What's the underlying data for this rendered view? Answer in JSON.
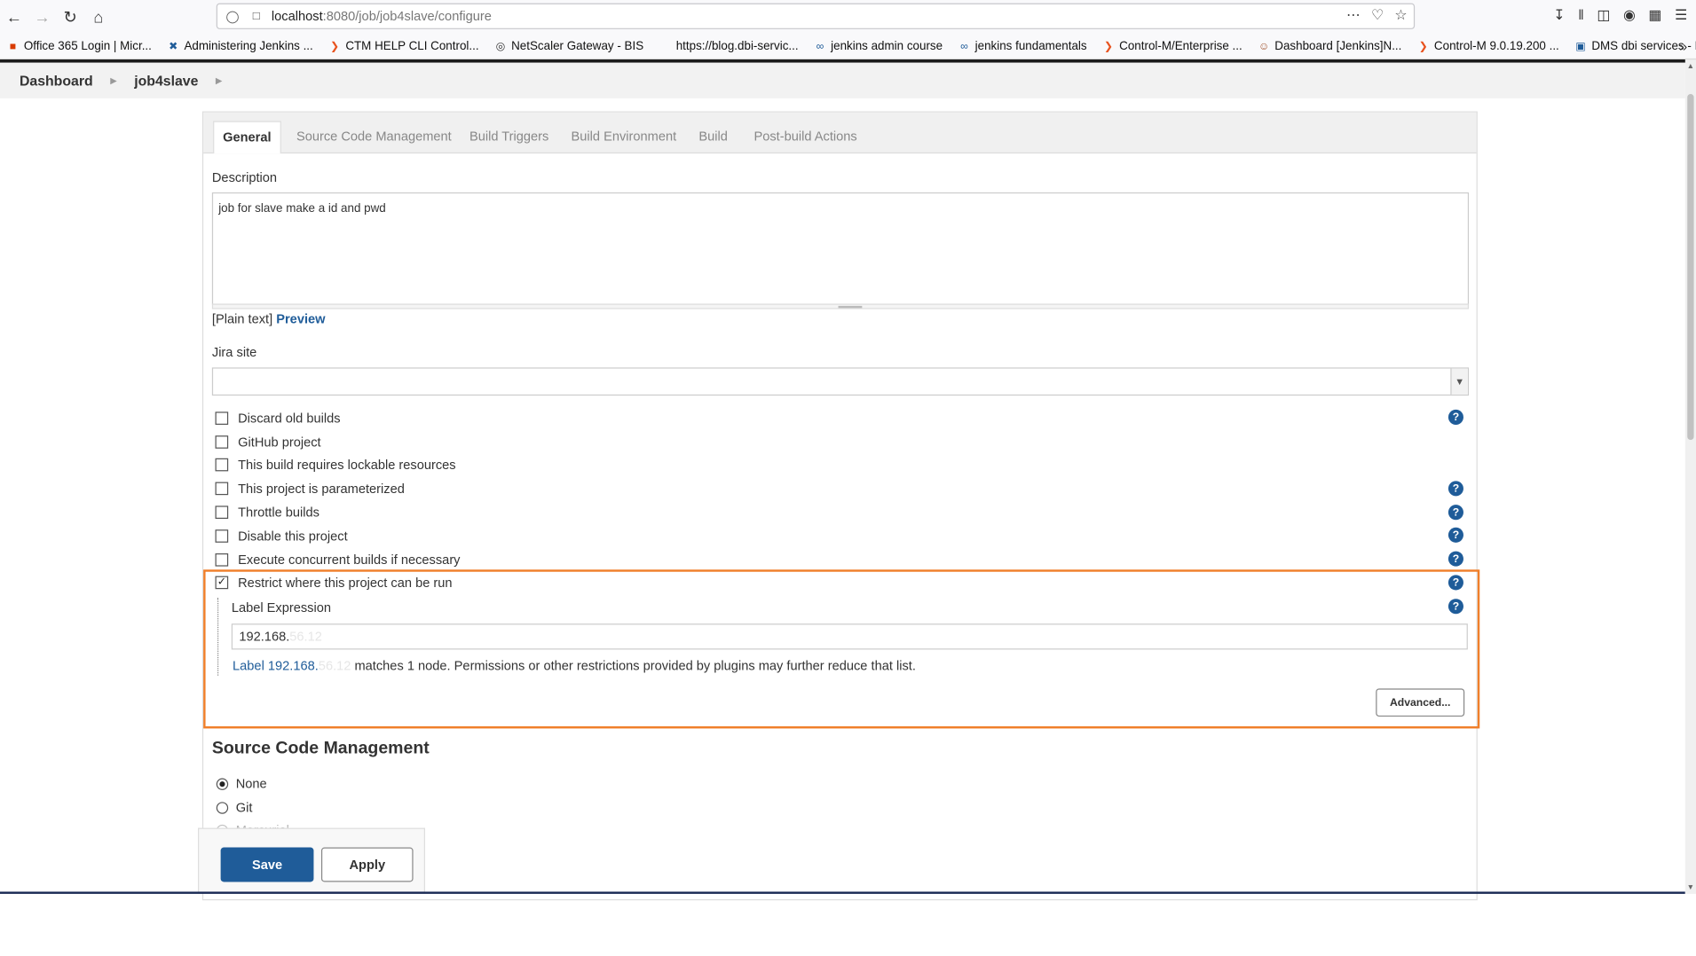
{
  "browser": {
    "url_host": "localhost",
    "url_rest": ":8080/job/job4slave/configure"
  },
  "bookmarks": [
    {
      "label": "Office 365 Login | Micr...",
      "icon": "office-icon",
      "color": "#d83b01"
    },
    {
      "label": "Administering Jenkins ...",
      "icon": "jenkins-cross-icon",
      "color": "#1f5c99"
    },
    {
      "label": "CTM HELP CLI Control...",
      "icon": "controlm-icon",
      "color": "#e8531f"
    },
    {
      "label": "NetScaler Gateway - BIS",
      "icon": "netscaler-icon",
      "color": "#333333"
    },
    {
      "label": "https://blog.dbi-servic...",
      "icon": "page-icon",
      "color": "#888888"
    },
    {
      "label": "jenkins admin course",
      "icon": "link-icon",
      "color": "#1f5c99"
    },
    {
      "label": "jenkins fundamentals",
      "icon": "link-icon",
      "color": "#1f5c99"
    },
    {
      "label": "Control-M/Enterprise ...",
      "icon": "controlm-icon",
      "color": "#e8531f"
    },
    {
      "label": "Dashboard [Jenkins]N...",
      "icon": "jenkins-icon",
      "color": "#a0522d"
    },
    {
      "label": "Control-M 9.0.19.200 ...",
      "icon": "controlm-icon",
      "color": "#e8531f"
    },
    {
      "label": "DMS dbi services - Intr...",
      "icon": "dbi-icon",
      "color": "#1f5c99"
    }
  ],
  "breadcrumb": {
    "dashboard": "Dashboard",
    "job": "job4slave"
  },
  "tabs": [
    "General",
    "Source Code Management",
    "Build Triggers",
    "Build Environment",
    "Build",
    "Post-build Actions"
  ],
  "general": {
    "description_label": "Description",
    "description_value": "job for slave make a id and pwd",
    "plain_text": "[Plain text]",
    "preview": "Preview",
    "jira_label": "Jira site",
    "jira_value": ""
  },
  "options": [
    {
      "label": "Discard old builds",
      "checked": false,
      "help": true
    },
    {
      "label": "GitHub project",
      "checked": false,
      "help": false
    },
    {
      "label": "This build requires lockable resources",
      "checked": false,
      "help": false
    },
    {
      "label": "This project is parameterized",
      "checked": false,
      "help": true
    },
    {
      "label": "Throttle builds",
      "checked": false,
      "help": true
    },
    {
      "label": "Disable this project",
      "checked": false,
      "help": true
    },
    {
      "label": "Execute concurrent builds if necessary",
      "checked": false,
      "help": true
    },
    {
      "label": "Restrict where this project can be run",
      "checked": true,
      "help": true
    }
  ],
  "restrict": {
    "label_expression": "Label Expression",
    "value_visible": "192.168.",
    "value_blurred": "56.12",
    "match_link_visible": "Label 192.168.",
    "match_link_blurred": "56.12",
    "match_text": "matches 1 node. Permissions or other restrictions provided by plugins may further reduce that list.",
    "advanced": "Advanced..."
  },
  "scm": {
    "title": "Source Code Management",
    "options": [
      {
        "label": "None",
        "selected": true
      },
      {
        "label": "Git",
        "selected": false
      },
      {
        "label": "Mercurial",
        "selected": false
      }
    ]
  },
  "actions": {
    "save": "Save",
    "apply": "Apply"
  },
  "colors": {
    "accent": "#1f5c99",
    "highlight": "#f07f2a"
  }
}
